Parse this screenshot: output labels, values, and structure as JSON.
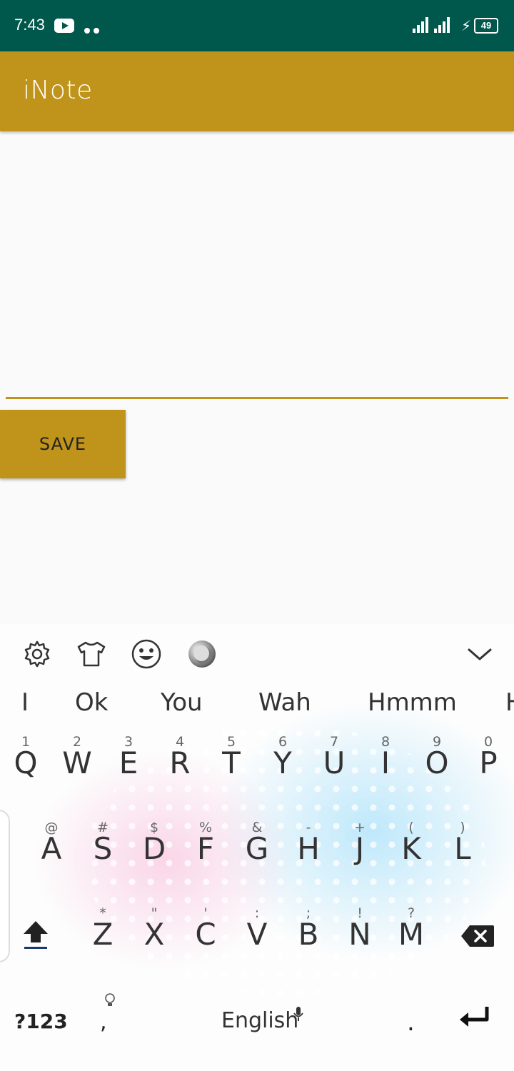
{
  "status_bar": {
    "time": "7:43",
    "battery": "49"
  },
  "app": {
    "title": "iNote"
  },
  "editor": {
    "save_label": "SAVE"
  },
  "keyboard": {
    "suggestions": [
      "I",
      "Ok",
      "You",
      "Wah",
      "Hmmm",
      "H"
    ],
    "row1": [
      {
        "hint": "1",
        "key": "Q"
      },
      {
        "hint": "2",
        "key": "W"
      },
      {
        "hint": "3",
        "key": "E"
      },
      {
        "hint": "4",
        "key": "R"
      },
      {
        "hint": "5",
        "key": "T"
      },
      {
        "hint": "6",
        "key": "Y"
      },
      {
        "hint": "7",
        "key": "U"
      },
      {
        "hint": "8",
        "key": "I"
      },
      {
        "hint": "9",
        "key": "O"
      },
      {
        "hint": "0",
        "key": "P"
      }
    ],
    "row2": [
      {
        "hint": "@",
        "key": "A"
      },
      {
        "hint": "#",
        "key": "S"
      },
      {
        "hint": "$",
        "key": "D"
      },
      {
        "hint": "%",
        "key": "F"
      },
      {
        "hint": "&",
        "key": "G"
      },
      {
        "hint": "-",
        "key": "H"
      },
      {
        "hint": "+",
        "key": "J"
      },
      {
        "hint": "(",
        "key": "K"
      },
      {
        "hint": ")",
        "key": "L"
      }
    ],
    "row3": [
      {
        "hint": "*",
        "key": "Z"
      },
      {
        "hint": "\"",
        "key": "X"
      },
      {
        "hint": "'",
        "key": "C"
      },
      {
        "hint": ":",
        "key": "V"
      },
      {
        "hint": ";",
        "key": "B"
      },
      {
        "hint": "!",
        "key": "N"
      },
      {
        "hint": "?",
        "key": "M"
      }
    ],
    "symbols_label": "?123",
    "comma": ",",
    "space_label": "English",
    "period": "."
  },
  "colors": {
    "accent": "#c0941a",
    "status_bar": "#00574b"
  },
  "icons": [
    "youtube-icon",
    "notification-dots-icon",
    "signal-icon",
    "charging-icon",
    "battery-icon",
    "settings-icon",
    "shirt-icon",
    "emoji-icon",
    "sticker-icon",
    "chevron-down-icon",
    "shift-icon",
    "backspace-icon",
    "lightbulb-icon",
    "mic-icon",
    "enter-icon"
  ]
}
